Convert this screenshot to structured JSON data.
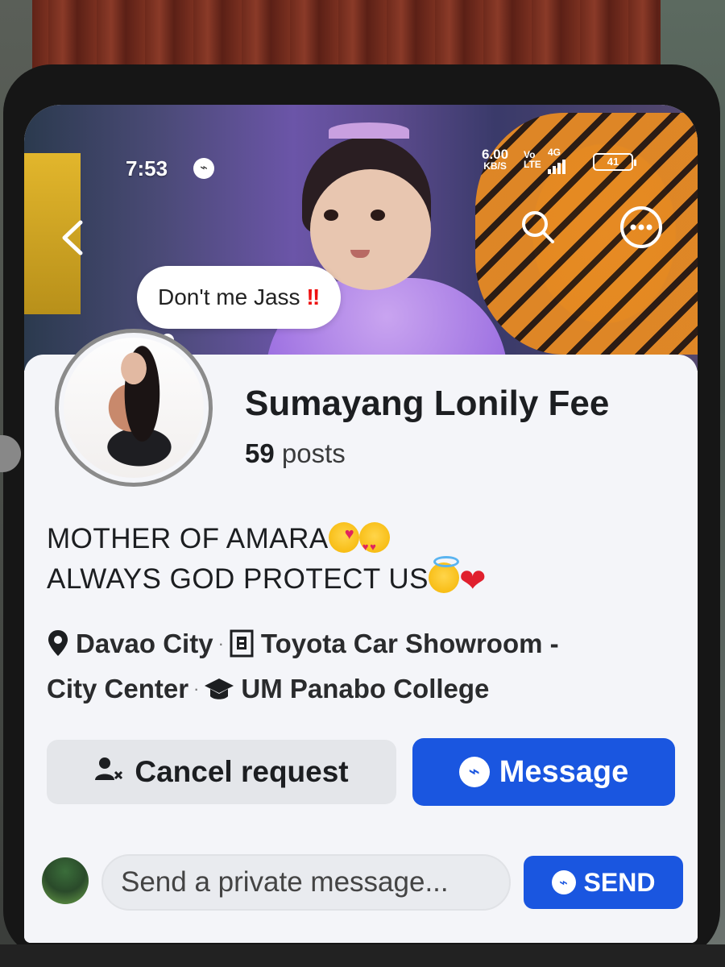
{
  "status_bar": {
    "time": "7:53",
    "speed_value": "6.00",
    "speed_unit": "KB/S",
    "volte_top": "Vo",
    "volte_bottom": "LTE",
    "network": "4G",
    "battery": "41"
  },
  "note": {
    "text": "Don't me Jass",
    "emphasis": "‼"
  },
  "profile": {
    "name": "Sumayang Lonily Fee",
    "posts_count": "59",
    "posts_label": "posts",
    "bio_line1": "MOTHER OF AMARA",
    "bio_line2": "ALWAYS GOD PROTECT US",
    "location": "Davao City",
    "work": "Toyota Car Showroom -",
    "work_cont": "City Center",
    "education": "UM Panabo College"
  },
  "actions": {
    "cancel_label": "Cancel request",
    "message_label": "Message"
  },
  "composer": {
    "placeholder": "Send a private message...",
    "send_label": "SEND"
  },
  "colors": {
    "accent": "#1a56e0",
    "secondary_button": "#e4e6ea",
    "card_background": "#f4f5f9"
  },
  "icons": [
    "back-arrow-icon",
    "search-icon",
    "more-icon",
    "messenger-icon",
    "location-pin-icon",
    "building-icon",
    "graduation-cap-icon",
    "cancel-friend-icon"
  ]
}
